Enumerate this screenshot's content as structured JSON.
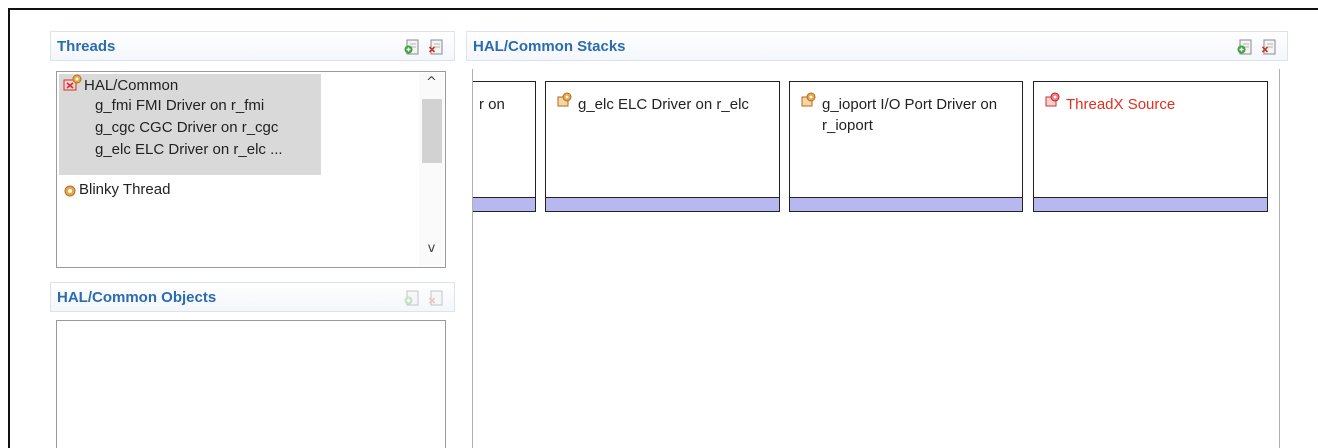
{
  "threads_panel": {
    "title": "Threads",
    "icons": [
      "add-icon",
      "remove-icon"
    ],
    "tree": [
      {
        "label": "HAL/Common",
        "icon": "hal-thread-icon",
        "selected": true
      },
      {
        "label": "g_fmi FMI Driver on r_fmi",
        "selected": true
      },
      {
        "label": "g_cgc CGC Driver on r_cgc",
        "selected": true
      },
      {
        "label": "g_elc ELC Driver on r_elc ...",
        "selected": true
      },
      {
        "label": "Blinky Thread",
        "icon": "thread-gear-icon",
        "selected": false
      }
    ],
    "scroll_up": "^",
    "scroll_down": "v"
  },
  "objects_panel": {
    "title": "HAL/Common Objects",
    "icons": [
      "add-icon",
      "remove-icon"
    ]
  },
  "stacks_panel": {
    "title": "HAL/Common Stacks",
    "icons": [
      "add-icon",
      "remove-icon"
    ],
    "modules": [
      {
        "label": "r on",
        "icon": null,
        "color": "#222222"
      },
      {
        "label": "g_elc ELC Driver on r_elc",
        "icon": "module-icon",
        "color": "#222222"
      },
      {
        "label": "g_ioport I/O Port Driver on r_ioport",
        "icon": "module-icon",
        "color": "#222222"
      },
      {
        "label": "ThreadX Source",
        "icon": "module-icon-red",
        "color": "#e0301e"
      }
    ],
    "module_bar_color": "#b8b8f0"
  }
}
